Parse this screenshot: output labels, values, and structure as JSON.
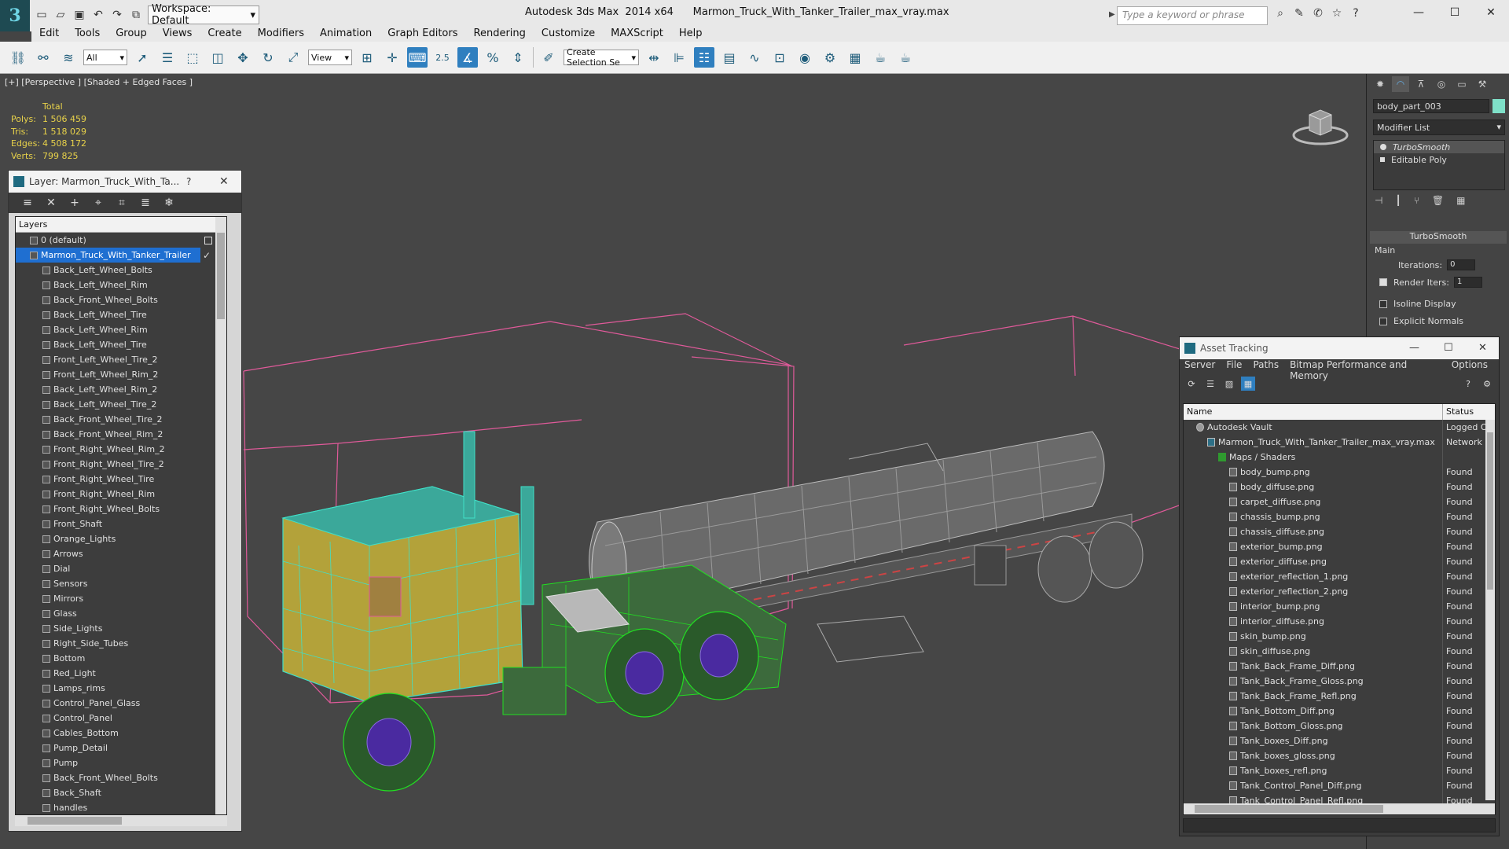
{
  "app": {
    "logo_letter": "3",
    "workspace": "Workspace: Default",
    "title": "Autodesk 3ds Max  2014 x64      Marmon_Truck_With_Tanker_Trailer_max_vray.max",
    "search_placeholder": "Type a keyword or phrase",
    "colors": {
      "accent": "#2f7fbf",
      "selection_cyan": "#40e0c8",
      "selection_green": "#22dd22",
      "stats_yellow": "#e8d24a"
    }
  },
  "menu": [
    "Edit",
    "Tools",
    "Group",
    "Views",
    "Create",
    "Modifiers",
    "Animation",
    "Graph Editors",
    "Rendering",
    "Customize",
    "MAXScript",
    "Help"
  ],
  "toolbar": {
    "filter_select": "All",
    "ref_coord_select": "View",
    "snap_label": "2.5",
    "selection_set_placeholder": "Create Selection Se"
  },
  "viewport": {
    "label": "[+] [Perspective ] [Shaded + Edged Faces ]",
    "stats": {
      "header": "Total",
      "rows": [
        {
          "label": "Polys:",
          "value": "1 506 459"
        },
        {
          "label": "Tris:",
          "value": "1 518 029"
        },
        {
          "label": "Edges:",
          "value": "4 508 172"
        },
        {
          "label": "Verts:",
          "value": "799 825"
        }
      ]
    }
  },
  "layer_window": {
    "title": "Layer: Marmon_Truck_With_Ta...",
    "help": "?",
    "header": "Layers",
    "default_layer": "0 (default)",
    "main_layer": "Marmon_Truck_With_Tanker_Trailer",
    "children": [
      "Back_Left_Wheel_Bolts",
      "Back_Left_Wheel_Rim",
      "Back_Front_Wheel_Bolts",
      "Back_Left_Wheel_Tire",
      "Back_Left_Wheel_Rim",
      "Back_Left_Wheel_Tire",
      "Front_Left_Wheel_Tire_2",
      "Front_Left_Wheel_Rim_2",
      "Back_Left_Wheel_Rim_2",
      "Back_Left_Wheel_Tire_2",
      "Back_Front_Wheel_Tire_2",
      "Back_Front_Wheel_Rim_2",
      "Front_Right_Wheel_Rim_2",
      "Front_Right_Wheel_Tire_2",
      "Front_Right_Wheel_Tire",
      "Front_Right_Wheel_Rim",
      "Front_Right_Wheel_Bolts",
      "Front_Shaft",
      "Orange_Lights",
      "Arrows",
      "Dial",
      "Sensors",
      "Mirrors",
      "Glass",
      "Side_Lights",
      "Right_Side_Tubes",
      "Bottom",
      "Red_Light",
      "Lamps_rims",
      "Control_Panel_Glass",
      "Control_Panel",
      "Cables_Bottom",
      "Pump_Detail",
      "Pump",
      "Back_Front_Wheel_Bolts",
      "Back_Shaft",
      "handles"
    ]
  },
  "command_panel": {
    "object_name": "body_part_003",
    "modifier_list": "Modifier List",
    "stack": [
      "TurboSmooth",
      "Editable Poly"
    ],
    "turbosmooth": {
      "title": "TurboSmooth",
      "group": "Main",
      "iterations_label": "Iterations:",
      "iterations_value": "0",
      "render_iters_label": "Render Iters:",
      "render_iters_value": "1",
      "isoline_label": "Isoline Display",
      "explicit_normals_label": "Explicit Normals"
    }
  },
  "asset_window": {
    "title": "Asset Tracking",
    "menu": [
      "Server",
      "File",
      "Paths",
      "Bitmap Performance and Memory",
      "Options"
    ],
    "columns": [
      "Name",
      "Status"
    ],
    "rows": [
      {
        "name": "Autodesk Vault",
        "status": "Logged Out",
        "level": 0,
        "type": "vault"
      },
      {
        "name": "Marmon_Truck_With_Tanker_Trailer_max_vray.max",
        "status": "Network",
        "level": 1,
        "type": "file"
      },
      {
        "name": "Maps / Shaders",
        "status": "",
        "level": 2,
        "type": "folder"
      },
      {
        "name": "body_bump.png",
        "status": "Found",
        "level": 3,
        "type": "map"
      },
      {
        "name": "body_diffuse.png",
        "status": "Found",
        "level": 3,
        "type": "map"
      },
      {
        "name": "carpet_diffuse.png",
        "status": "Found",
        "level": 3,
        "type": "map"
      },
      {
        "name": "chassis_bump.png",
        "status": "Found",
        "level": 3,
        "type": "map"
      },
      {
        "name": "chassis_diffuse.png",
        "status": "Found",
        "level": 3,
        "type": "map"
      },
      {
        "name": "exterior_bump.png",
        "status": "Found",
        "level": 3,
        "type": "map"
      },
      {
        "name": "exterior_diffuse.png",
        "status": "Found",
        "level": 3,
        "type": "map"
      },
      {
        "name": "exterior_reflection_1.png",
        "status": "Found",
        "level": 3,
        "type": "map"
      },
      {
        "name": "exterior_reflection_2.png",
        "status": "Found",
        "level": 3,
        "type": "map"
      },
      {
        "name": "interior_bump.png",
        "status": "Found",
        "level": 3,
        "type": "map"
      },
      {
        "name": "interior_diffuse.png",
        "status": "Found",
        "level": 3,
        "type": "map"
      },
      {
        "name": "skin_bump.png",
        "status": "Found",
        "level": 3,
        "type": "map"
      },
      {
        "name": "skin_diffuse.png",
        "status": "Found",
        "level": 3,
        "type": "map"
      },
      {
        "name": "Tank_Back_Frame_Diff.png",
        "status": "Found",
        "level": 3,
        "type": "map"
      },
      {
        "name": "Tank_Back_Frame_Gloss.png",
        "status": "Found",
        "level": 3,
        "type": "map"
      },
      {
        "name": "Tank_Back_Frame_Refl.png",
        "status": "Found",
        "level": 3,
        "type": "map"
      },
      {
        "name": "Tank_Bottom_Diff.png",
        "status": "Found",
        "level": 3,
        "type": "map"
      },
      {
        "name": "Tank_Bottom_Gloss.png",
        "status": "Found",
        "level": 3,
        "type": "map"
      },
      {
        "name": "Tank_boxes_Diff.png",
        "status": "Found",
        "level": 3,
        "type": "map"
      },
      {
        "name": "Tank_boxes_gloss.png",
        "status": "Found",
        "level": 3,
        "type": "map"
      },
      {
        "name": "Tank_boxes_refl.png",
        "status": "Found",
        "level": 3,
        "type": "map"
      },
      {
        "name": "Tank_Control_Panel_Diff.png",
        "status": "Found",
        "level": 3,
        "type": "map"
      },
      {
        "name": "Tank_Control_Panel_Refl.png",
        "status": "Found",
        "level": 3,
        "type": "map"
      }
    ]
  }
}
